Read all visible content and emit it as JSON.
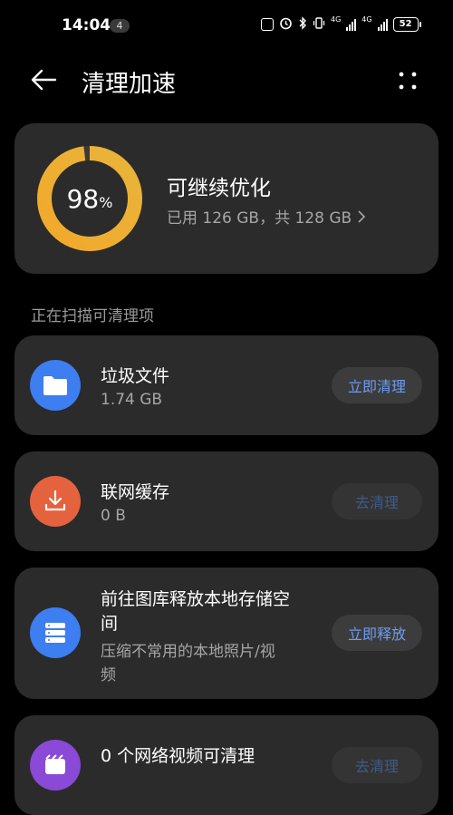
{
  "status_bar": {
    "time": "14:04",
    "notification_count": "4",
    "net_1": "4G",
    "net_2": "4G",
    "battery": "52"
  },
  "header": {
    "title": "清理加速"
  },
  "storage": {
    "percent": "98",
    "percent_sign": "%",
    "used_fraction": 0.98,
    "status": "可继续优化",
    "detail": "已用 126 GB，共 128 GB",
    "ring_color_start": "#f2a92b",
    "ring_color_end": "#e8b43a"
  },
  "section_label": "正在扫描可清理项",
  "items": [
    {
      "title": "垃圾文件",
      "sub": "1.74 GB",
      "action": "立即清理",
      "icon": "folder-icon",
      "color": "#3d7ef0"
    },
    {
      "title": "联网缓存",
      "sub": "0 B",
      "action": "去清理",
      "icon": "download-icon",
      "color": "#e5623e"
    },
    {
      "title_line1": "前往图库释放本地存储空",
      "title_line2": "间",
      "sub_line1": "压缩不常用的本地照片/视",
      "sub_line2": "频",
      "action": "立即释放",
      "icon": "storage-icon",
      "color": "#3d7ef0"
    },
    {
      "title": "0 个网络视频可清理",
      "action": "去清理",
      "icon": "video-icon",
      "color": "#8a49d6"
    }
  ],
  "colors": {
    "accent": "#6d9cf2",
    "card_bg": "#2b2b2b",
    "background": "#000000"
  }
}
